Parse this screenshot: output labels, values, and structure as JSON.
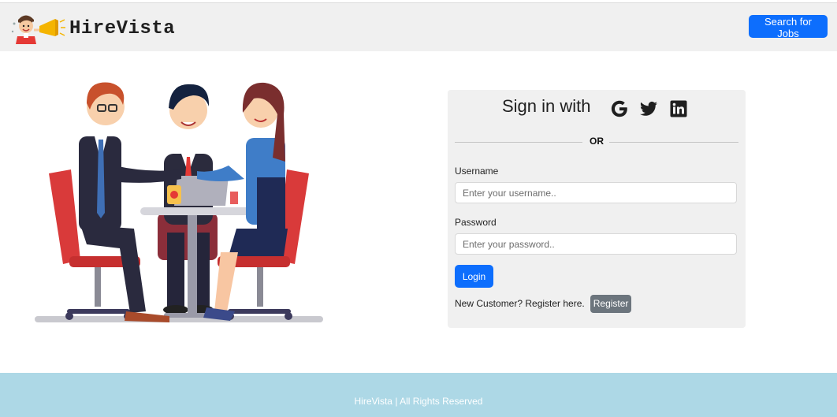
{
  "brand": {
    "name": "HireVista",
    "logo_icon": "cartoon-man-megaphone-icon"
  },
  "header": {
    "search_jobs_label": "Search for Jobs"
  },
  "illustration": {
    "icon": "business-meeting-handshake-illustration"
  },
  "login": {
    "title": "Sign in with",
    "social_icons": [
      "google-icon",
      "twitter-icon",
      "linkedin-icon"
    ],
    "divider_text": "OR",
    "username_label": "Username",
    "username_placeholder": "Enter your username..",
    "password_label": "Password",
    "password_placeholder": "Enter your password..",
    "login_label": "Login",
    "register_prompt": "New Customer? Register here.",
    "register_label": "Register"
  },
  "footer": {
    "text": "HireVista | All Rights Reserved"
  },
  "colors": {
    "primary": "#0d6efd",
    "secondary": "#6c757d",
    "navbar_bg": "#f0f0f0",
    "card_bg": "#f0f0f0",
    "footer_bg": "#add8e6"
  }
}
